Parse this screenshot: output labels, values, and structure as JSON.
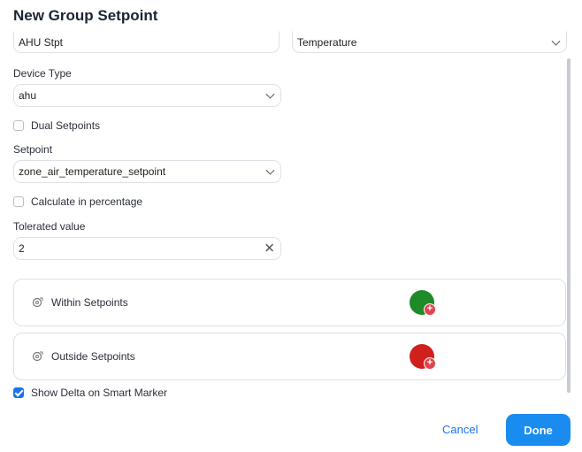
{
  "dialog": {
    "title": "New Group Setpoint"
  },
  "form": {
    "name_value": "AHU Stpt",
    "category_value": "Temperature",
    "device_type_label": "Device Type",
    "device_type_value": "ahu",
    "dual_setpoints_label": "Dual Setpoints",
    "dual_setpoints_checked": false,
    "setpoint_label": "Setpoint",
    "setpoint_value": "zone_air_temperature_setpoint",
    "calc_percentage_label": "Calculate in percentage",
    "calc_percentage_checked": false,
    "tolerated_label": "Tolerated value",
    "tolerated_value": "2"
  },
  "markers": [
    {
      "label": "Within Setpoints",
      "color": "#1e8a28",
      "icon": "marker-settings-icon"
    },
    {
      "label": "Outside Setpoints",
      "color": "#d0201b",
      "icon": "marker-settings-icon"
    }
  ],
  "show_delta": {
    "label": "Show Delta on Smart Marker",
    "checked": true
  },
  "actions": {
    "cancel_label": "Cancel",
    "done_label": "Done"
  },
  "colors": {
    "accent": "#1a8cf0",
    "link": "#1a73e8"
  }
}
